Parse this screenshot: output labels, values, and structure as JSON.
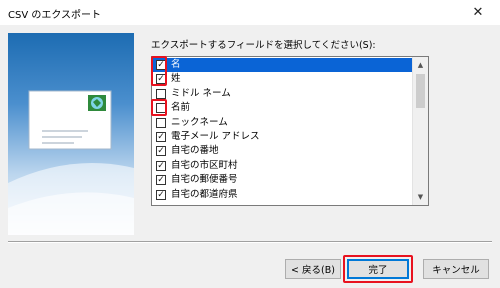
{
  "window": {
    "title": "CSV のエクスポート",
    "close_glyph": "✕"
  },
  "prompt": "エクスポートするフィールドを選択してください(S):",
  "fields": [
    {
      "label": "名",
      "checked": true,
      "selected": true
    },
    {
      "label": "姓",
      "checked": true,
      "selected": false
    },
    {
      "label": "ミドル ネーム",
      "checked": false,
      "selected": false
    },
    {
      "label": "名前",
      "checked": false,
      "selected": false
    },
    {
      "label": "ニックネーム",
      "checked": false,
      "selected": false
    },
    {
      "label": "電子メール アドレス",
      "checked": true,
      "selected": false
    },
    {
      "label": "自宅の番地",
      "checked": true,
      "selected": false
    },
    {
      "label": "自宅の市区町村",
      "checked": true,
      "selected": false
    },
    {
      "label": "自宅の郵便番号",
      "checked": true,
      "selected": false
    },
    {
      "label": "自宅の都道府県",
      "checked": true,
      "selected": false
    }
  ],
  "buttons": {
    "back": "< 戻る(B)",
    "finish": "完了",
    "cancel": "キャンセル"
  },
  "colors": {
    "highlight": "#e8121f",
    "selection": "#0a64d6",
    "default_border": "#0078d7"
  },
  "icons": {
    "close": "close-icon",
    "scroll_up": "scroll-up-icon",
    "scroll_down": "scroll-down-icon",
    "wizard": "envelope-icon"
  }
}
